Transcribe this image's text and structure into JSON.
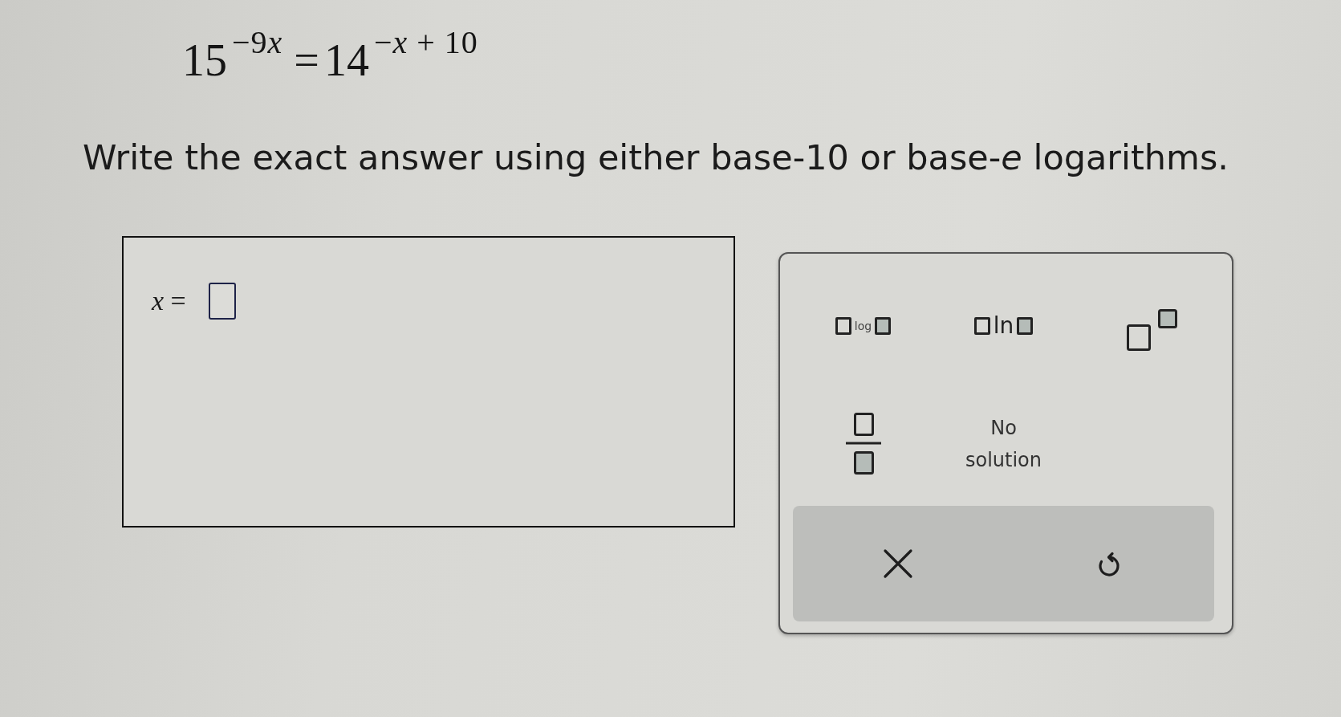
{
  "equation": {
    "left": {
      "base": "15",
      "exponent": [
        {
          "text": "−9",
          "italic": false
        },
        {
          "text": "x",
          "italic": true
        }
      ]
    },
    "sign": "=",
    "right": {
      "base": "14",
      "exponent": [
        {
          "text": "−",
          "italic": false
        },
        {
          "text": "x",
          "italic": true
        },
        {
          "text": " + 10",
          "italic": false
        }
      ]
    }
  },
  "instruction": "Write the exact answer using either base-10 or base-*e* logarithms.",
  "answer": {
    "label": "*x* ="
  },
  "keypad": {
    "keys": [
      {
        "kind": "log",
        "label": "log"
      },
      {
        "kind": "ln",
        "label": "ln"
      },
      {
        "kind": "power"
      },
      {
        "kind": "fraction"
      },
      {
        "kind": "text",
        "label": "No solution"
      }
    ]
  }
}
